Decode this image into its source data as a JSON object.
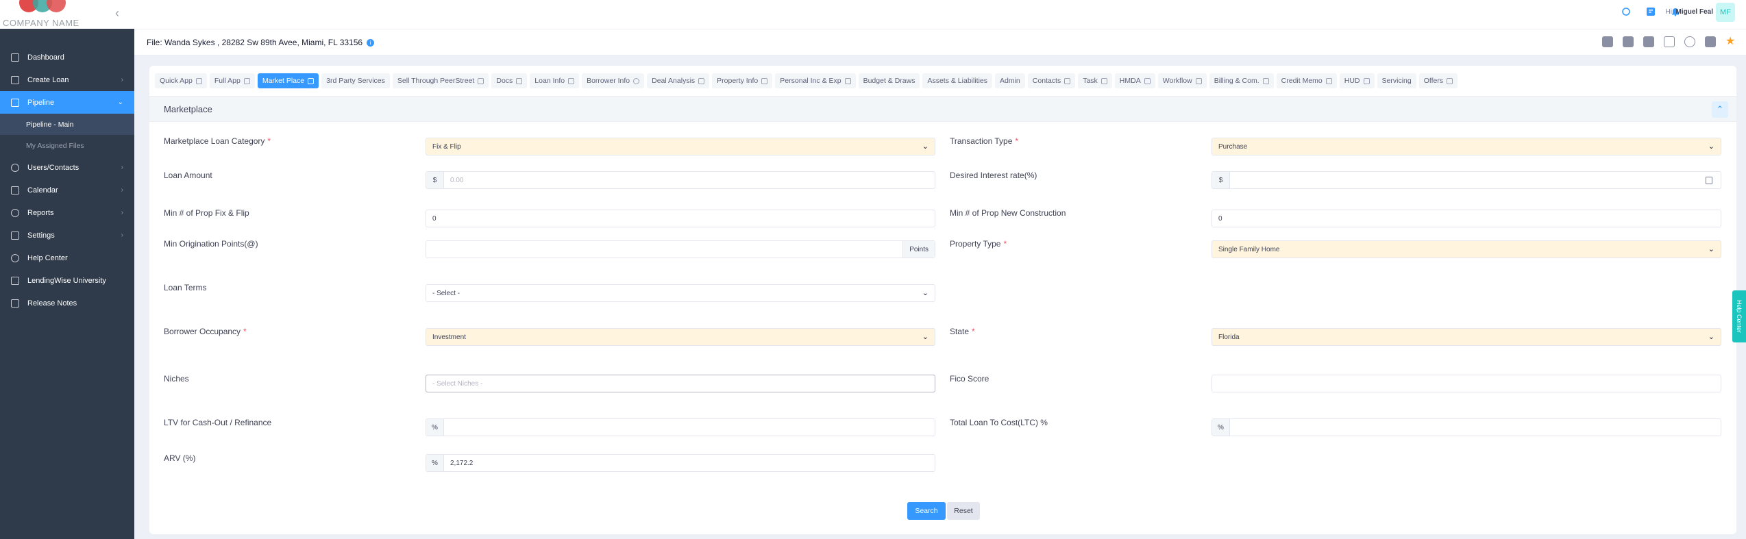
{
  "brand": {
    "company": "COMPANY NAME"
  },
  "sidebar": {
    "items": [
      {
        "label": "Dashboard"
      },
      {
        "label": "Create Loan"
      },
      {
        "label": "Pipeline"
      },
      {
        "label": "Users/Contacts"
      },
      {
        "label": "Calendar"
      },
      {
        "label": "Reports"
      },
      {
        "label": "Settings"
      },
      {
        "label": "Help Center"
      },
      {
        "label": "LendingWise University"
      },
      {
        "label": "Release Notes"
      }
    ],
    "pipeline_sub": [
      {
        "label": "Pipeline - Main"
      },
      {
        "label": "My Assigned Files"
      }
    ]
  },
  "topbar": {
    "greeting": "Hi,",
    "user_name": "Miguel Feal",
    "avatar_initials": "MF"
  },
  "file": {
    "title": "File: Wanda Sykes , 28282 Sw 89th Avee, Miami, FL 33156"
  },
  "tabs": [
    {
      "label": "Quick App",
      "icon": "document-icon"
    },
    {
      "label": "Full App",
      "icon": "document-icon"
    },
    {
      "label": "Market Place",
      "icon": "cart-icon"
    },
    {
      "label": "3rd Party Services",
      "icon": ""
    },
    {
      "label": "Sell Through PeerStreet",
      "icon": "signal-icon"
    },
    {
      "label": "Docs",
      "icon": "folder-icon"
    },
    {
      "label": "Loan Info",
      "icon": "percent-icon"
    },
    {
      "label": "Borrower Info",
      "icon": "user-icon"
    },
    {
      "label": "Deal Analysis",
      "icon": "calculator-icon"
    },
    {
      "label": "Property Info",
      "icon": "home-icon"
    },
    {
      "label": "Personal Inc & Exp",
      "icon": "calculator-icon"
    },
    {
      "label": "Budget & Draws",
      "icon": ""
    },
    {
      "label": "Assets & Liabilities",
      "icon": ""
    },
    {
      "label": "Admin",
      "icon": ""
    },
    {
      "label": "Contacts",
      "icon": "users-icon"
    },
    {
      "label": "Task",
      "icon": "list-icon"
    },
    {
      "label": "HMDA",
      "icon": "lock-icon"
    },
    {
      "label": "Workflow",
      "icon": "list-icon"
    },
    {
      "label": "Billing & Com.",
      "icon": "card-icon"
    },
    {
      "label": "Credit Memo",
      "icon": "list-icon"
    },
    {
      "label": "HUD",
      "icon": "home-icon"
    },
    {
      "label": "Servicing",
      "icon": ""
    },
    {
      "label": "Offers",
      "icon": "gift-icon"
    }
  ],
  "section": {
    "title": "Marketplace"
  },
  "form": {
    "loan_category": {
      "label": "Marketplace Loan Category",
      "value": "Fix & Flip"
    },
    "transaction_type": {
      "label": "Transaction Type",
      "value": "Purchase"
    },
    "loan_amount": {
      "label": "Loan Amount",
      "addon": "$",
      "placeholder": "0.00"
    },
    "interest_rate": {
      "label": "Desired Interest rate(%)",
      "addon": "$",
      "value": ""
    },
    "min_prop_fix": {
      "label": "Min # of Prop Fix & Flip",
      "value": "0"
    },
    "min_prop_new": {
      "label": "Min # of Prop New Construction",
      "value": "0"
    },
    "orig_points": {
      "label": "Min Origination Points(@)",
      "value": "",
      "suffix": "Points"
    },
    "property_type": {
      "label": "Property Type",
      "value": "Single Family Home"
    },
    "loan_terms": {
      "label": "Loan Terms",
      "value": "- Select -"
    },
    "occupancy": {
      "label": "Borrower Occupancy",
      "value": "Investment"
    },
    "state": {
      "label": "State",
      "value": "Florida"
    },
    "niches": {
      "label": "Niches",
      "placeholder": "- Select Niches -"
    },
    "fico": {
      "label": "Fico Score",
      "value": ""
    },
    "ltv": {
      "label": "LTV for Cash-Out / Refinance",
      "addon": "%",
      "value": ""
    },
    "ltc": {
      "label": "Total Loan To Cost(LTC) %",
      "addon": "%",
      "value": ""
    },
    "arv": {
      "label": "ARV (%)",
      "addon": "%",
      "value": "2,172.2"
    },
    "required_mark": "*"
  },
  "actions": {
    "search": "Search",
    "reset": "Reset"
  },
  "help_tab": "Help Center",
  "colors": {
    "primary": "#3699ff",
    "sidebar": "#2f3a4a",
    "select_bg": "#fff4de",
    "help": "#1bc5bd"
  }
}
